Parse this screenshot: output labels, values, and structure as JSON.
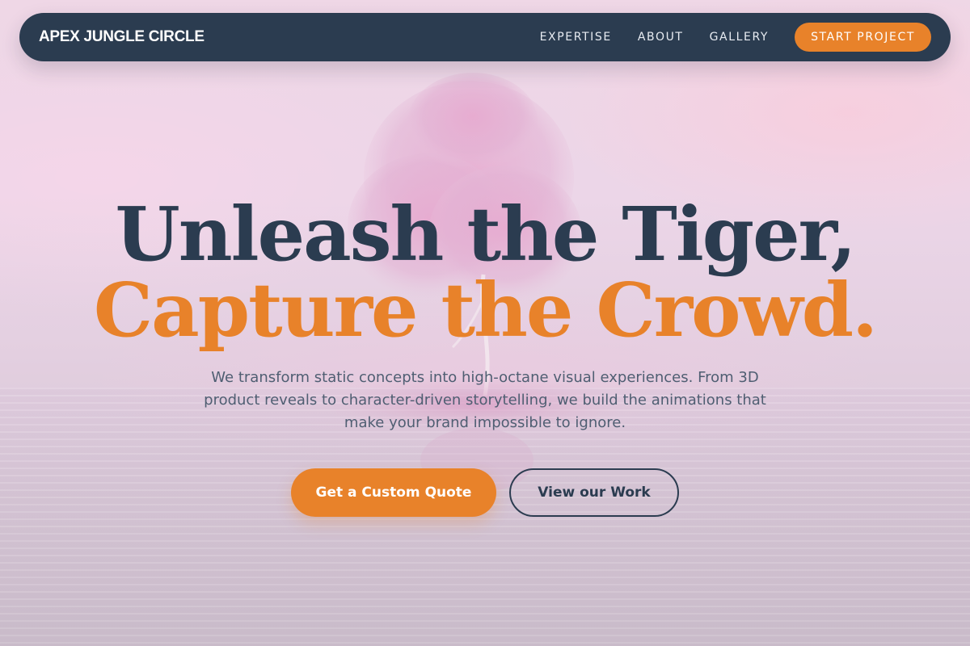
{
  "colors": {
    "navy": "#2b3c50",
    "orange": "#e8822a",
    "subtext": "#4f5e72",
    "background": "#ecd6e8"
  },
  "nav": {
    "brand": "APEX JUNGLE CIRCLE",
    "links": [
      {
        "label": "EXPERTISE"
      },
      {
        "label": "ABOUT"
      },
      {
        "label": "GALLERY"
      }
    ],
    "cta_label": "START PROJECT"
  },
  "hero": {
    "headline_line1": "Unleash the Tiger,",
    "headline_line2": "Capture the Crowd.",
    "subtext": "We transform static concepts into high-octane visual experiences. From 3D product reveals to character-driven storytelling, we build the animations that make your brand impossible to ignore.",
    "primary_button": "Get a Custom Quote",
    "secondary_button": "View our Work"
  },
  "background": {
    "scene": "pink blossom tree on a small island reflected in calm water"
  }
}
